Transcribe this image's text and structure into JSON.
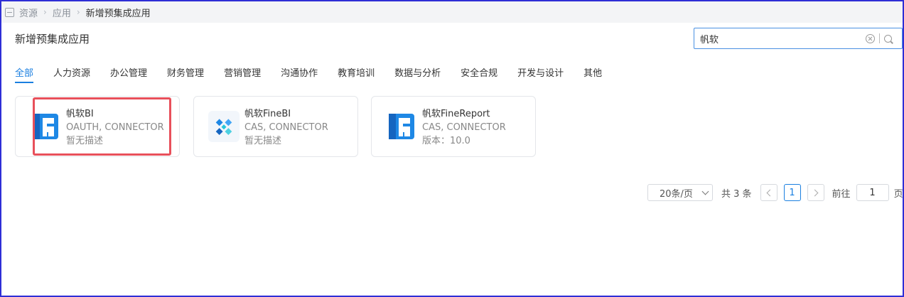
{
  "breadcrumb": {
    "items": [
      "资源",
      "应用",
      "新增预集成应用"
    ]
  },
  "page": {
    "title": "新增预集成应用"
  },
  "search": {
    "value": "帆软"
  },
  "tabs": [
    {
      "label": "全部",
      "active": true
    },
    {
      "label": "人力资源"
    },
    {
      "label": "办公管理"
    },
    {
      "label": "财务管理"
    },
    {
      "label": "营销管理"
    },
    {
      "label": "沟通协作"
    },
    {
      "label": "教育培训"
    },
    {
      "label": "数据与分析"
    },
    {
      "label": "安全合规"
    },
    {
      "label": "开发与设计"
    },
    {
      "label": "其他"
    }
  ],
  "cards": [
    {
      "name": "帆软BI",
      "protocols": "OAUTH, CONNECTOR",
      "detail": "暂无描述",
      "logo": "fanruan-f-logo-icon",
      "highlighted": true
    },
    {
      "name": "帆软FineBI",
      "protocols": "CAS, CONNECTOR",
      "detail": "暂无描述",
      "logo": "finebi-logo-icon"
    },
    {
      "name": "帆软FineReport",
      "protocols": "CAS, CONNECTOR",
      "detail": "版本：10.0",
      "logo": "fanruan-f-logo-icon"
    }
  ],
  "pagination": {
    "page_size": "20条/页",
    "total": "共 3 条",
    "current_page": "1",
    "goto_label": "前往",
    "goto_value": "1",
    "goto_suffix": "页"
  },
  "colors": {
    "accent": "#1a7fe0",
    "highlight": "#e8505b",
    "frame": "#2e2ed6"
  }
}
